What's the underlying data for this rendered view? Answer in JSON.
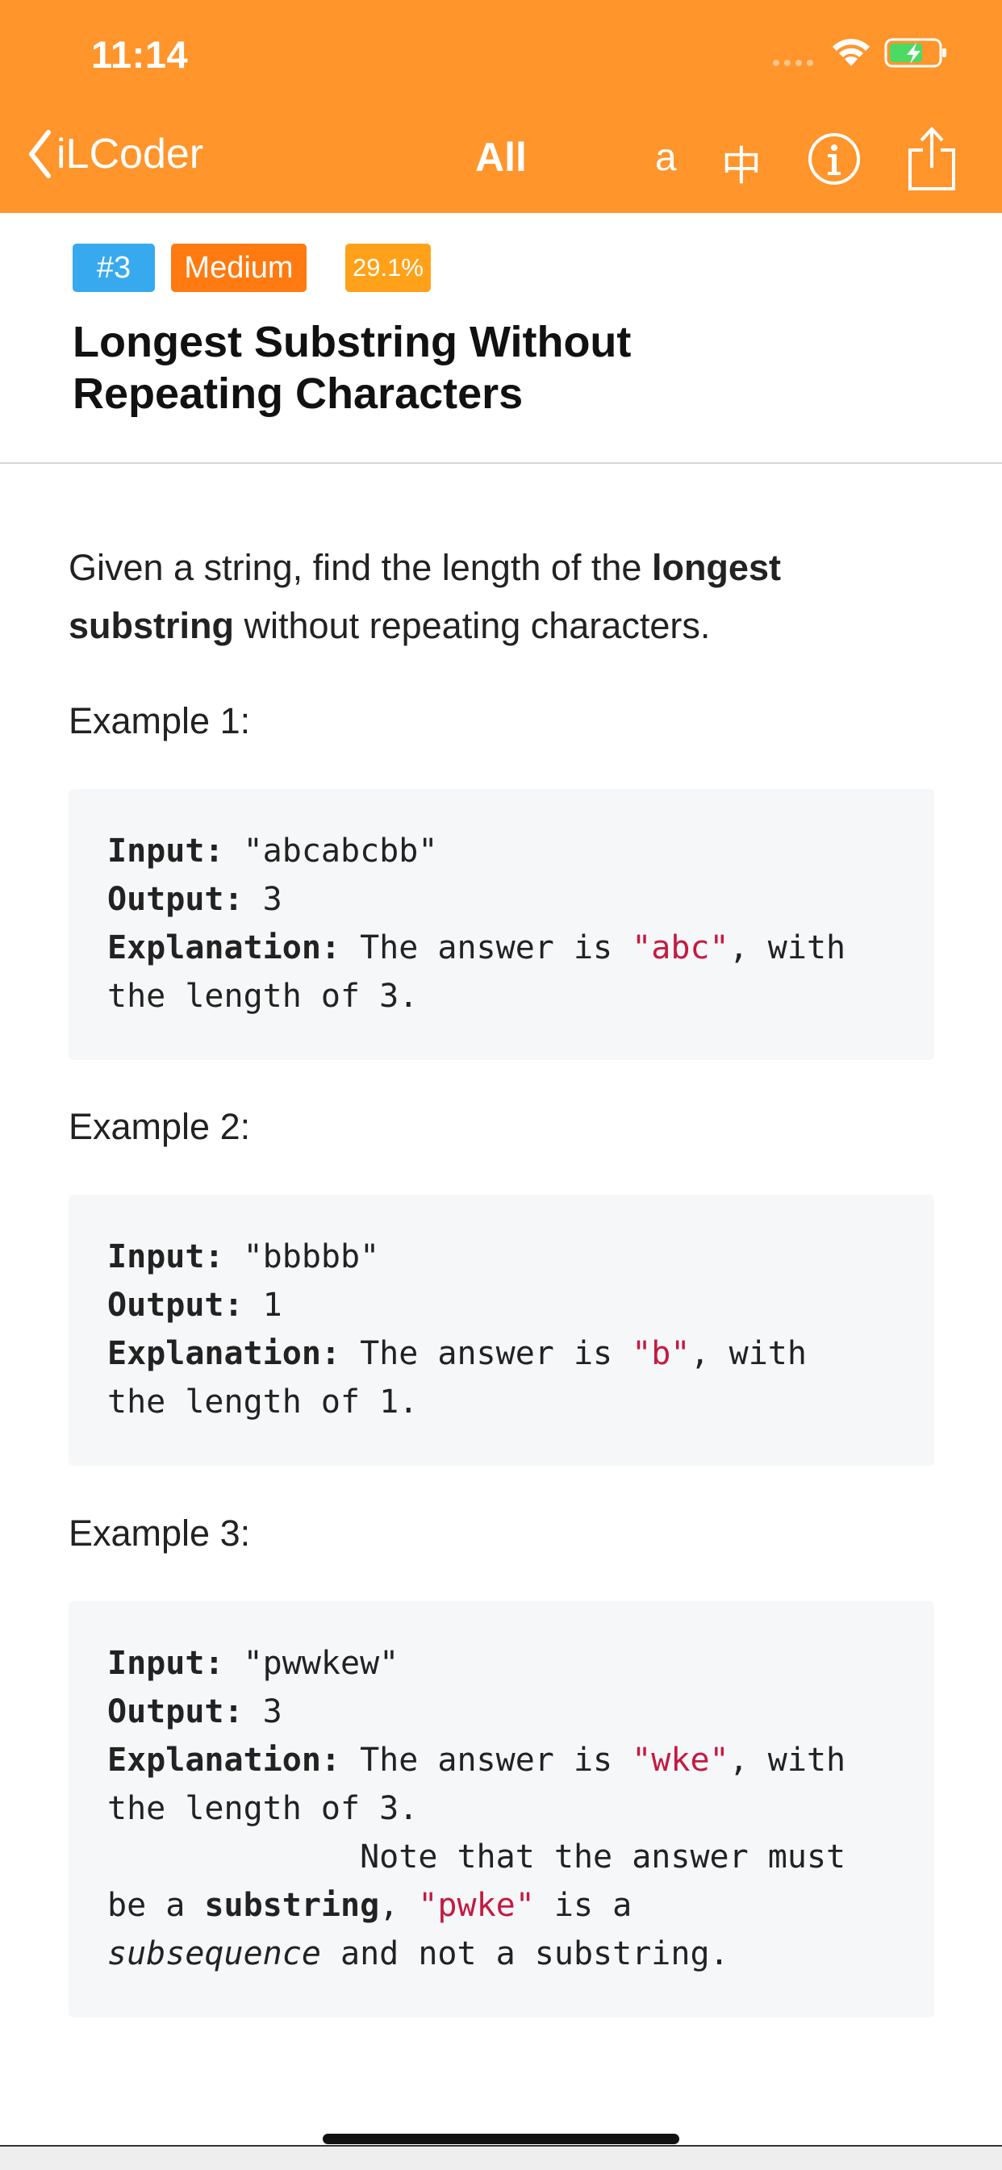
{
  "status": {
    "time": "11:14"
  },
  "nav": {
    "back_label": "iLCoder",
    "title": "All",
    "lang_en": "a",
    "lang_zh": "中"
  },
  "problem": {
    "id": "#3",
    "difficulty": "Medium",
    "acceptance": "29.1%",
    "title_line1": "Longest Substring Without",
    "title_line2": "Repeating Characters"
  },
  "intro": {
    "p1": "Given a string, find the length of the ",
    "b1": "longest",
    "b2": "substring",
    "p2": " without repeating characters."
  },
  "examples": [
    {
      "heading": "Example 1:",
      "input_label": "Input:",
      "input": " \"abcabcbb\"",
      "output_label": "Output:",
      "output": " 3",
      "explanation_label": "Explanation:",
      "explanation_pre": " The answer is ",
      "explanation_str": "\"abc\"",
      "explanation_post": ", with",
      "explanation_line2": "the length of 3."
    },
    {
      "heading": "Example 2:",
      "input_label": "Input:",
      "input": " \"bbbbb\"",
      "output_label": "Output:",
      "output": " 1",
      "explanation_label": "Explanation:",
      "explanation_pre": " The answer is ",
      "explanation_str": "\"b\"",
      "explanation_post": ", with",
      "explanation_line2": "the length of 1."
    },
    {
      "heading": "Example 3:",
      "input_label": "Input:",
      "input": " \"pwwkew\"",
      "output_label": "Output:",
      "output": " 3",
      "explanation_label": "Explanation:",
      "explanation_pre": " The answer is ",
      "explanation_str": "\"wke\"",
      "explanation_post": ", with",
      "explanation_line2": "the length of 3.",
      "note_line1": "             Note that the answer must",
      "note_pre": "be a ",
      "note_bold": "substring",
      "note_mid": ", ",
      "note_str": "\"pwke\"",
      "note_post": " is a",
      "note_italic": "subsequence",
      "note_end": " and not a substring."
    }
  ],
  "colors": {
    "header": "#FF952B",
    "tag_id": "#37A9EF",
    "tag_level": "#FF7A10",
    "tag_rate": "#FFA21A",
    "code_string": "#C41A41",
    "code_bg": "#F6F7F9"
  },
  "icons": [
    "back-chevron-icon",
    "wifi-icon",
    "battery-charging-icon",
    "info-icon",
    "share-icon"
  ]
}
